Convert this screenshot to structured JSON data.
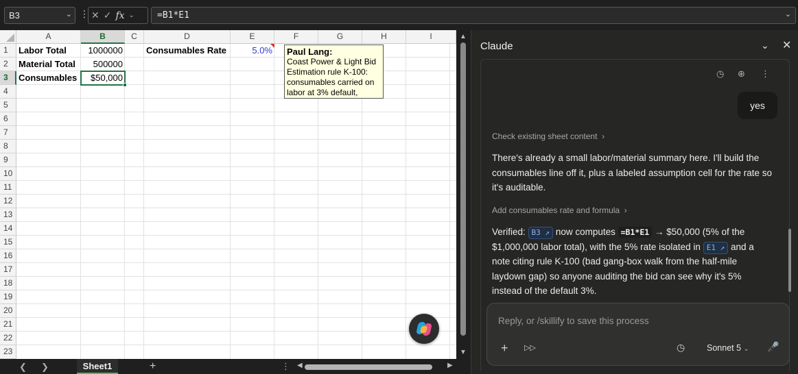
{
  "formula_bar": {
    "name_box": "B3",
    "formula": "=B1*E1",
    "fx_label": "fx"
  },
  "columns": [
    "A",
    "B",
    "C",
    "D",
    "E",
    "F",
    "G",
    "H",
    "I"
  ],
  "rows": [
    "1",
    "2",
    "3",
    "4",
    "5",
    "6",
    "7",
    "8",
    "9",
    "10",
    "11",
    "12",
    "13",
    "14",
    "15",
    "16",
    "17",
    "18",
    "19",
    "20",
    "21",
    "22",
    "23"
  ],
  "cells": {
    "A1": "Labor Total",
    "B1": "1000000",
    "D1": "Consumables Rate",
    "E1": "5.0%",
    "A2": "Material Total",
    "B2": "500000",
    "A3": "Consumables",
    "B3": "$50,000"
  },
  "comment": {
    "author": "Paul Lang:",
    "lines": [
      "Coast Power & Light Bid",
      "Estimation rule K-100:",
      "consumables carried on",
      "labor at 3% default,"
    ]
  },
  "sheet_tabs": {
    "active": "Sheet1"
  },
  "panel": {
    "title": "Claude",
    "user_message": "yes",
    "step1": "Check existing sheet content",
    "message1": "There's already a small labor/material summary here. I'll build the consumables line off it, plus a labeled assumption cell for the rate so it's auditable.",
    "step2": "Add consumables rate and formula",
    "verified_prefix": "Verified:",
    "chip_b3": "B3 ↗",
    "now_computes": "now computes",
    "code_formula": "=B1*E1",
    "arrow_result": "→ $50,000 (5% of the $1,000,000 labor total), with the 5% rate isolated in",
    "chip_e1": "E1 ↗",
    "verified_suffix": "and a note citing rule K-100 (bad gang-box walk from the half-mile laydown gap) so anyone auditing the bid can see why it's 5% instead of the default 3%.",
    "composer_placeholder": "Reply, or /skillify to save this process",
    "model": "Sonnet 5"
  }
}
